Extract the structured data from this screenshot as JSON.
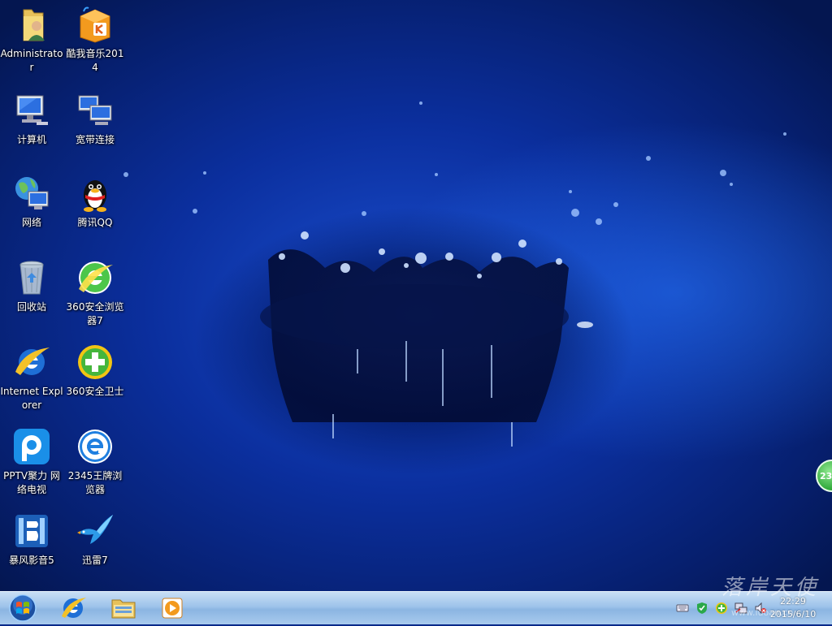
{
  "desktop": {
    "icons": [
      {
        "label": "Administrator",
        "icon": "user-folder-icon"
      },
      {
        "label": "酷我音乐2014",
        "icon": "kuwo-music-icon"
      },
      {
        "label": "计算机",
        "icon": "computer-icon"
      },
      {
        "label": "宽带连接",
        "icon": "broadband-connection-icon"
      },
      {
        "label": "网络",
        "icon": "network-icon"
      },
      {
        "label": "腾讯QQ",
        "icon": "qq-penguin-icon"
      },
      {
        "label": "回收站",
        "icon": "recycle-bin-icon"
      },
      {
        "label": "360安全浏览器7",
        "icon": "360-browser-icon"
      },
      {
        "label": "Internet Explorer",
        "icon": "internet-explorer-icon"
      },
      {
        "label": "360安全卫士",
        "icon": "360-security-icon"
      },
      {
        "label": "PPTV聚力 网络电视",
        "icon": "pptv-icon"
      },
      {
        "label": "2345王牌浏览器",
        "icon": "2345-browser-icon"
      },
      {
        "label": "暴风影音5",
        "icon": "baofeng-player-icon"
      },
      {
        "label": "迅雷7",
        "icon": "xunlei-bird-icon"
      }
    ]
  },
  "taskbar": {
    "start_icon": "windows-start-orb-icon",
    "pinned": [
      "internet-explorer-icon",
      "file-explorer-icon",
      "media-player-icon"
    ],
    "tray": {
      "icons": [
        "keyboard-icon",
        "security-shield-icon",
        "360-plus-icon",
        "network-status-icon",
        "volume-muted-icon"
      ],
      "time": "22:29",
      "date": "2015/6/10"
    }
  },
  "overlay": {
    "watermark": "落岸天使",
    "watermark_url": "www.luoan.cn",
    "side_widget": "23"
  },
  "colors": {
    "wallpaper_dark": "#041650",
    "wallpaper_mid": "#0b2f9e",
    "wallpaper_light": "#3a7cff",
    "taskbar": "#9ec3ea"
  }
}
